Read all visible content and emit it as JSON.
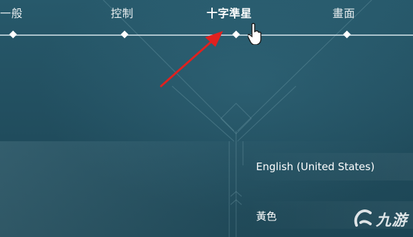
{
  "tabs": [
    {
      "label": "一般"
    },
    {
      "label": "控制"
    },
    {
      "label": "十字準星"
    },
    {
      "label": "畫面"
    }
  ],
  "active_tab": "十字準星",
  "settings": {
    "language": {
      "value": "English (United States)"
    },
    "crosshair_color": {
      "value": "黃色"
    }
  },
  "watermark": {
    "text": "九游"
  },
  "colors": {
    "background": "#1f4a5a",
    "text": "#ffffff",
    "annotation_arrow": "#e0211f"
  },
  "icons": {
    "cursor": "hand-pointer-icon",
    "arrow": "annotation-arrow-icon",
    "watermark": "jiuyou-logo-icon"
  }
}
